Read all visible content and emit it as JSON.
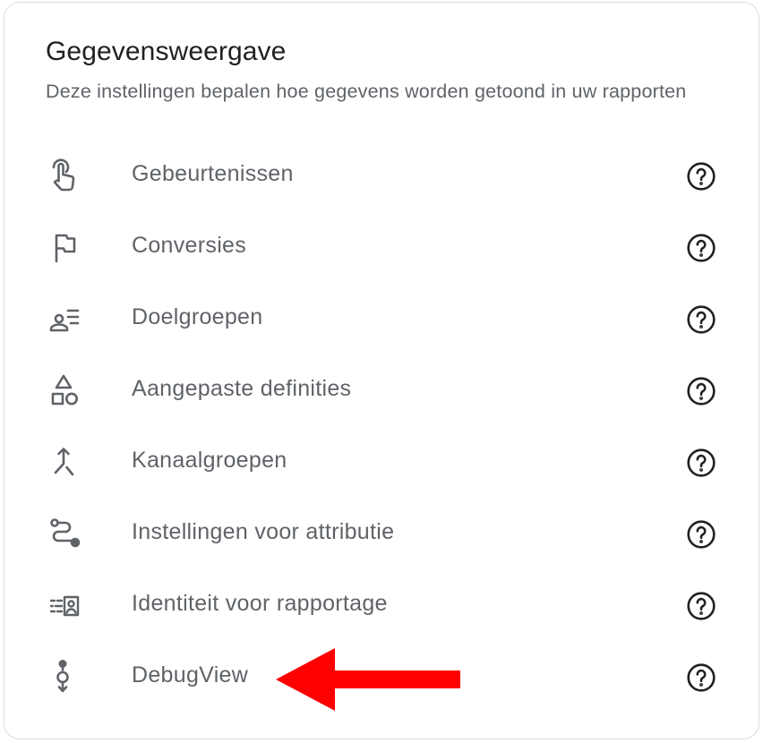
{
  "section": {
    "title": "Gegevensweergave",
    "description": "Deze instellingen bepalen hoe gegevens worden getoond in uw rapporten"
  },
  "items": [
    {
      "label": "Gebeurtenissen",
      "icon": "touch-hand-icon"
    },
    {
      "label": "Conversies",
      "icon": "flag-icon"
    },
    {
      "label": "Doelgroepen",
      "icon": "audience-list-icon"
    },
    {
      "label": "Aangepaste definities",
      "icon": "shapes-icon"
    },
    {
      "label": "Kanaalgroepen",
      "icon": "merge-arrow-icon"
    },
    {
      "label": "Instellingen voor attributie",
      "icon": "route-icon"
    },
    {
      "label": "Identiteit voor rapportage",
      "icon": "identity-report-icon"
    },
    {
      "label": "DebugView",
      "icon": "debug-view-icon"
    }
  ],
  "annotation": {
    "icon": "red-arrow-icon",
    "color": "#ff0000"
  },
  "colors": {
    "icon": "#5f6368",
    "help_icon": "#202124",
    "title": "#202124",
    "text": "#5f6368",
    "border": "#dadce0"
  }
}
